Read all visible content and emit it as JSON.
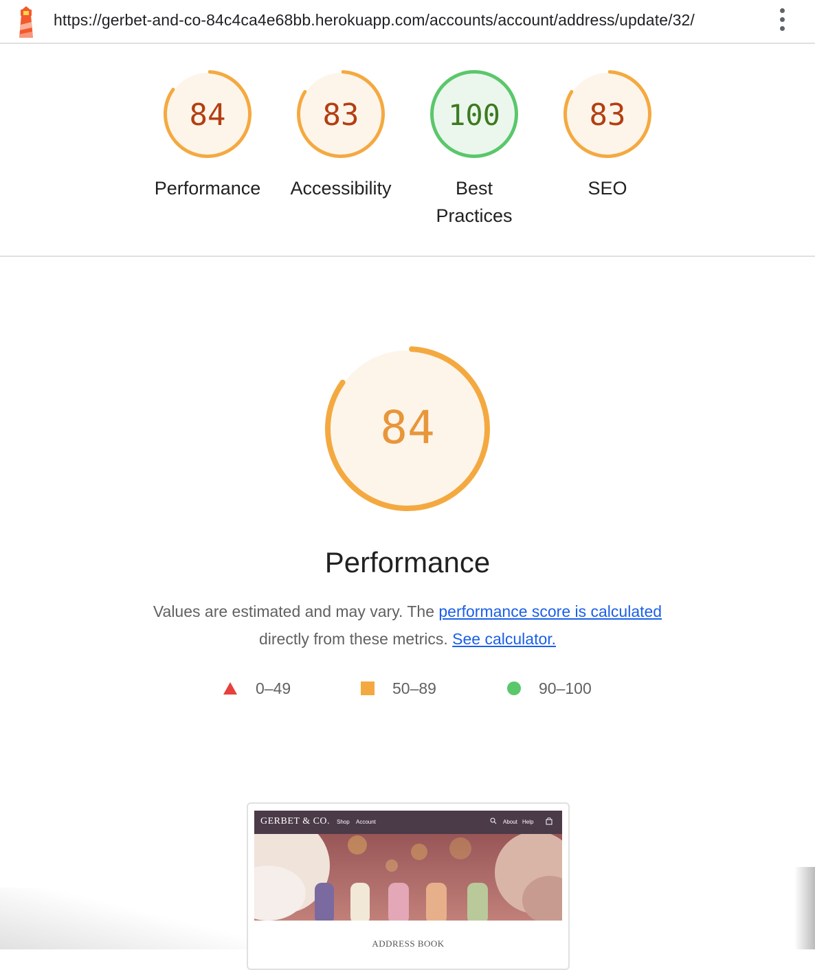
{
  "header": {
    "url": "https://gerbet-and-co-84c4ca4e68bb.herokuapp.com/accounts/account/address/update/32/",
    "logo_icon": "lighthouse-icon",
    "menu_icon": "kebab-menu-icon"
  },
  "colors": {
    "average": "#f4a940",
    "average_text": "#b33f12",
    "average_fill": "#fdf5ea",
    "pass": "#5ac76b",
    "pass_text": "#3d7a20",
    "pass_fill": "#ebf7ed",
    "fail": "#e8403d",
    "link": "#1a5fe8"
  },
  "scores": [
    {
      "score": 84,
      "label": "Performance",
      "rating": "average"
    },
    {
      "score": 83,
      "label": "Accessibility",
      "rating": "average"
    },
    {
      "score": 100,
      "label": "Best Practices",
      "label_line1": "Best",
      "label_line2": "Practices",
      "rating": "pass"
    },
    {
      "score": 83,
      "label": "SEO",
      "rating": "average"
    }
  ],
  "performance": {
    "score": 84,
    "title": "Performance",
    "desc_prefix": "Values are estimated and may vary. The",
    "desc_link": "performance score is calculated",
    "desc_mid": "directly from these metrics.",
    "desc_link2": "See calculator."
  },
  "legend": [
    {
      "icon": "triangle-fail-icon",
      "range": "0–49"
    },
    {
      "icon": "square-average-icon",
      "range": "50–89"
    },
    {
      "icon": "circle-pass-icon",
      "range": "90–100"
    }
  ],
  "thumbnail": {
    "brand": "GERBET & CO.",
    "nav_shop": "Shop",
    "nav_account": "Account",
    "nav_about": "About",
    "nav_help": "Help",
    "caption": "ADDRESS BOOK"
  }
}
